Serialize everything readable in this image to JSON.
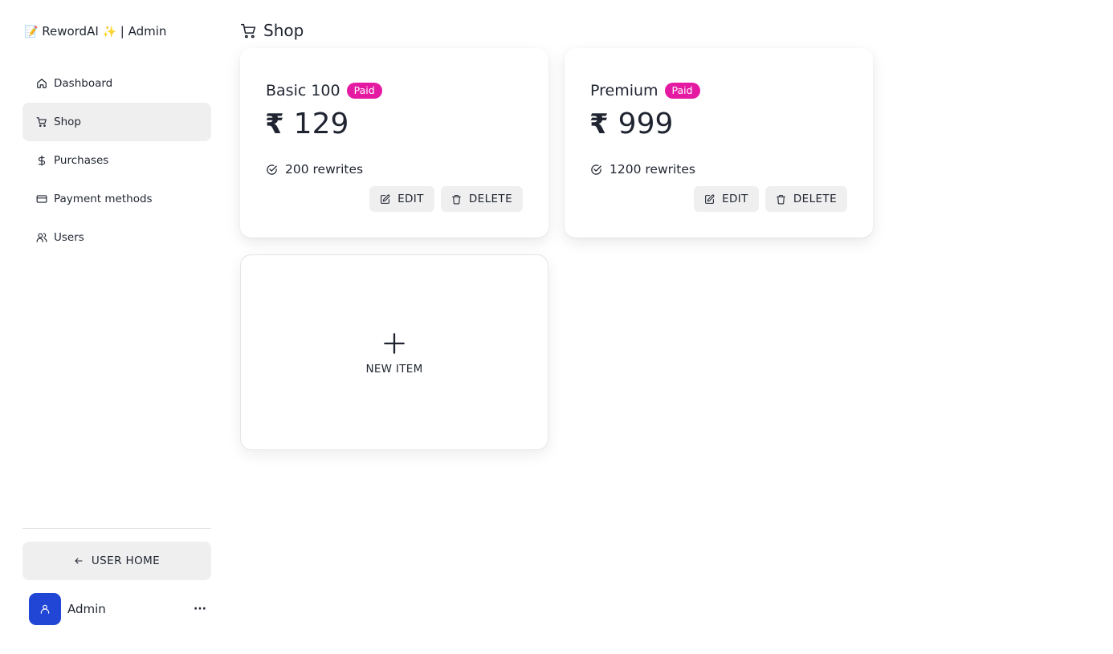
{
  "brand": {
    "prefix_emoji": "📝",
    "name": "RewordAI",
    "sparkle_emoji": "✨",
    "suffix": "| Admin"
  },
  "sidebar": {
    "items": [
      {
        "label": "Dashboard",
        "icon": "home-icon",
        "active": false
      },
      {
        "label": "Shop",
        "icon": "cart-icon",
        "active": true
      },
      {
        "label": "Purchases",
        "icon": "dollar-icon",
        "active": false
      },
      {
        "label": "Payment methods",
        "icon": "credit-card-icon",
        "active": false
      },
      {
        "label": "Users",
        "icon": "users-icon",
        "active": false
      }
    ],
    "home_button_label": "USER HOME",
    "user": {
      "name": "Admin",
      "more": "···"
    }
  },
  "header": {
    "title": "Shop"
  },
  "products": [
    {
      "name": "Basic 100",
      "badge": "Paid",
      "currency": "₹",
      "price": "129",
      "feature": "200 rewrites",
      "edit_label": "EDIT",
      "delete_label": "DELETE"
    },
    {
      "name": "Premium",
      "badge": "Paid",
      "currency": "₹",
      "price": "999",
      "feature": "1200 rewrites",
      "edit_label": "EDIT",
      "delete_label": "DELETE"
    }
  ],
  "new_item": {
    "label": "NEW ITEM"
  },
  "colors": {
    "badge": "#e51aa3",
    "avatar": "#2146d6",
    "active_bg": "#efefef",
    "text": "#1f2430"
  }
}
